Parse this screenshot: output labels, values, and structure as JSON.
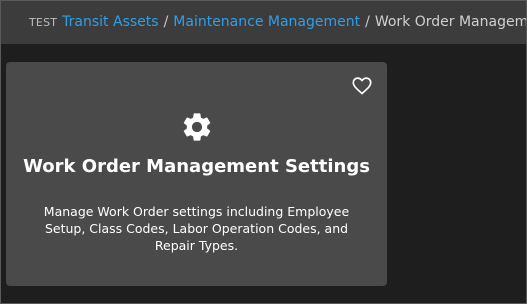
{
  "breadcrumb": {
    "env_tag": "TEST",
    "items": [
      {
        "label": "Transit Assets"
      },
      {
        "label": "Maintenance Management"
      }
    ],
    "separator": "/",
    "current": "Work Order Management"
  },
  "card": {
    "title": "Work Order Management Settings",
    "description": "Manage Work Order settings including Employee Setup, Class Codes, Labor Operation Codes, and Repair Types.",
    "icon": "gear-icon",
    "favorite_icon": "heart-outline-icon"
  },
  "colors": {
    "topbar_bg": "#3c3c3c",
    "page_bg": "#1e1e1e",
    "card_bg": "#4a4a4a",
    "link": "#2f9fe6"
  }
}
